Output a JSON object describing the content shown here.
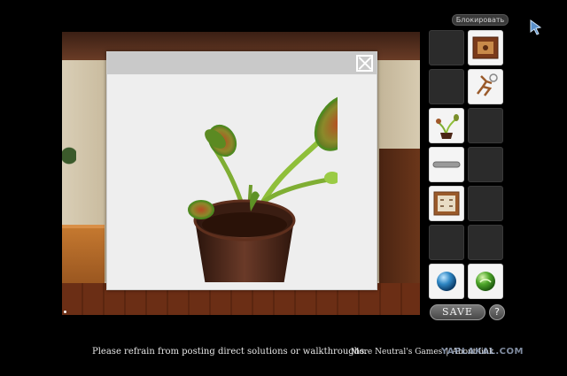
{
  "toolbar": {
    "block_label": "Блокировать"
  },
  "popup": {
    "item_shown": "venus-flytrap",
    "close_icon": "close-icon"
  },
  "inventory": {
    "slots": [
      {
        "item": "empty"
      },
      {
        "item": "wooden-picture-frame"
      },
      {
        "item": "empty"
      },
      {
        "item": "stick-figure-puzzle"
      },
      {
        "item": "flytrap-plant"
      },
      {
        "item": "empty"
      },
      {
        "item": "metal-bar"
      },
      {
        "item": "empty"
      },
      {
        "item": "framed-picture"
      },
      {
        "item": "empty"
      },
      {
        "item": "empty"
      },
      {
        "item": "empty"
      },
      {
        "item": "blue-orb"
      },
      {
        "item": "green-orb"
      }
    ]
  },
  "buttons": {
    "save_label": "SAVE",
    "help_label": "?"
  },
  "footer": {
    "notice": "Please refrain from posting direct solutions or walkthroughs.",
    "more_games": "More Neutral's Games",
    "separator": "|",
    "about": "About link"
  },
  "watermark": "YAPLAKAL.COM",
  "colors": {
    "background": "#000000",
    "popup": "#eeeeee",
    "slot_empty": "#2b2b2b",
    "slot_filled": "#f4f4f4"
  }
}
